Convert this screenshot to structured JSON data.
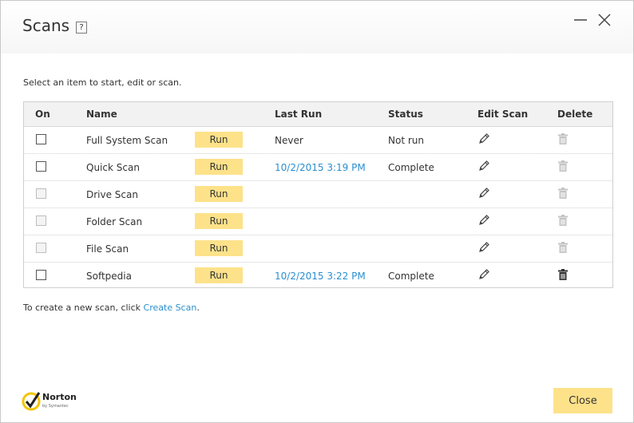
{
  "window": {
    "title": "Scans",
    "help_label": "?"
  },
  "instruction": "Select an item to start, edit or scan.",
  "table": {
    "headers": {
      "on": "On",
      "name": "Name",
      "last_run": "Last Run",
      "status": "Status",
      "edit": "Edit Scan",
      "delete": "Delete"
    },
    "rows": [
      {
        "name": "Full System Scan",
        "run_label": "Run",
        "last_run": "Never",
        "status": "Not run",
        "checkbox_enabled": true,
        "delete_enabled": false,
        "last_run_is_link": false
      },
      {
        "name": "Quick Scan",
        "run_label": "Run",
        "last_run": "10/2/2015 3:19 PM",
        "status": "Complete",
        "checkbox_enabled": true,
        "delete_enabled": false,
        "last_run_is_link": true
      },
      {
        "name": "Drive Scan",
        "run_label": "Run",
        "last_run": "",
        "status": "",
        "checkbox_enabled": false,
        "delete_enabled": false,
        "last_run_is_link": false
      },
      {
        "name": "Folder Scan",
        "run_label": "Run",
        "last_run": "",
        "status": "",
        "checkbox_enabled": false,
        "delete_enabled": false,
        "last_run_is_link": false
      },
      {
        "name": "File Scan",
        "run_label": "Run",
        "last_run": "",
        "status": "",
        "checkbox_enabled": false,
        "delete_enabled": false,
        "last_run_is_link": false
      },
      {
        "name": "Softpedia",
        "run_label": "Run",
        "last_run": "10/2/2015 3:22 PM",
        "status": "Complete",
        "checkbox_enabled": true,
        "delete_enabled": true,
        "last_run_is_link": true
      }
    ]
  },
  "footer": {
    "prefix": "To create a new scan, click ",
    "link": "Create Scan",
    "suffix": "."
  },
  "logo": {
    "name": "Norton",
    "sub": "by Symantec"
  },
  "close_label": "Close",
  "colors": {
    "accent_button": "#fde28a",
    "link": "#2a8fcf",
    "logo_yellow": "#f5c400"
  },
  "icons": {
    "edit": "pencil-icon",
    "delete": "trash-icon",
    "minimize": "minimize-icon",
    "close": "close-icon"
  }
}
